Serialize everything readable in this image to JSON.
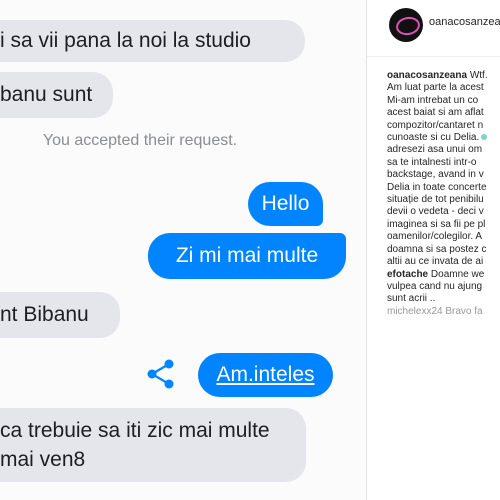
{
  "chat": {
    "messages": [
      {
        "text": "i sa vii pana la noi la studio"
      },
      {
        "text": "banu sunt"
      },
      {
        "text": "Hello"
      },
      {
        "text": "Zi mi mai multe"
      },
      {
        "text": "nt Bibanu"
      },
      {
        "text": "Am.inteles"
      },
      {
        "text": "ca trebuie sa iti zic mai multe mai ven8"
      }
    ],
    "system_notice": "You accepted their request.",
    "share_icon": "share-icon",
    "colors": {
      "outgoing": "#0084ff",
      "incoming": "#e4e6eb"
    }
  },
  "instagram": {
    "username": "oanacosanzea",
    "caption_user": "oanacosanzeana",
    "caption_lines": [
      "Am luat parte la acest",
      "Mi-am intrebat un co",
      "acest baiat si am aflat",
      "compozitor/cantaret n",
      "cunoaste si cu Delia.",
      "adresezi asa unui om",
      "sa te intalnesti intr-o",
      "backstage, avand in v",
      "Delia in toate concerte",
      "situație de tot penibilu",
      "devii o vedeta - deci v",
      "imaginea si sa fii pe pl",
      "oamenilor/colegilor. A",
      "doamna si sa postez c",
      "altii au ce invata de ai"
    ],
    "caption_first": "Wtf.",
    "comments": [
      {
        "user": "efotache",
        "lines": [
          "Doamne we",
          "vulpea cand nu ajung",
          "sunt acrii .."
        ]
      },
      {
        "user": "michelexx24",
        "lines": [
          "Bravo fa"
        ]
      }
    ]
  }
}
